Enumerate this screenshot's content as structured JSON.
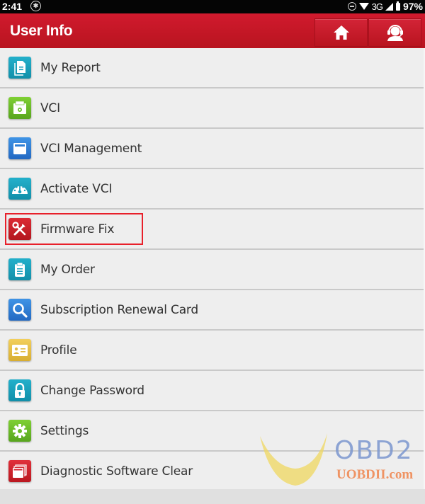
{
  "status_bar": {
    "time": "2:41",
    "bluetooth_icon": "bluetooth-icon",
    "network": "3G",
    "battery": "97%"
  },
  "app_bar": {
    "title": "User Info",
    "buttons": [
      {
        "name": "home",
        "icon": "home-icon"
      },
      {
        "name": "support",
        "icon": "headset-support-icon"
      }
    ],
    "color": "#c8182a"
  },
  "menu": {
    "items": [
      {
        "label": "My Report",
        "icon": "report-document-icon",
        "color": "#1aa1bd"
      },
      {
        "label": "VCI",
        "icon": "vci-connector-icon",
        "color": "#6cbd2a"
      },
      {
        "label": "VCI Management",
        "icon": "vci-management-icon",
        "color": "#2d7fd6"
      },
      {
        "label": "Activate VCI",
        "icon": "gauge-icon",
        "color": "#1aa1bd"
      },
      {
        "label": "Firmware Fix",
        "icon": "tools-icon",
        "color": "#c9202a",
        "highlighted": true
      },
      {
        "label": "My Order",
        "icon": "clipboard-icon",
        "color": "#1aa1bd"
      },
      {
        "label": "Subscription Renewal Card",
        "icon": "search-icon",
        "color": "#2d7fd6"
      },
      {
        "label": "Profile",
        "icon": "id-card-icon",
        "color": "#e7c046"
      },
      {
        "label": "Change Password",
        "icon": "lock-icon",
        "color": "#1aa1bd"
      },
      {
        "label": "Settings",
        "icon": "gear-icon",
        "color": "#6cbd2a"
      },
      {
        "label": "Diagnostic Software Clear",
        "icon": "window-stack-icon",
        "color": "#d3222e"
      }
    ]
  },
  "watermark": {
    "brand": "OBD2",
    "url": "UOBDII.com"
  }
}
